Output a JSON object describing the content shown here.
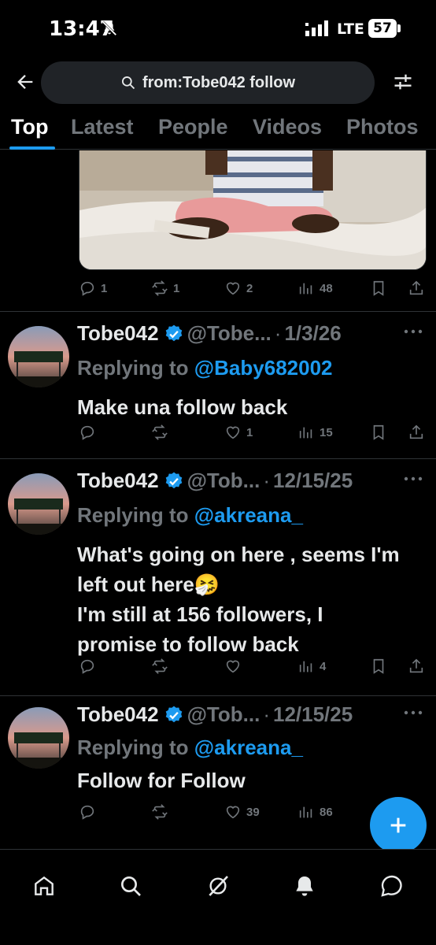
{
  "status_bar": {
    "time": "13:47",
    "network": "LTE",
    "battery": "57"
  },
  "search": {
    "query": "from:Tobe042 follow"
  },
  "tabs": [
    {
      "label": "Top",
      "active": true
    },
    {
      "label": "Latest",
      "active": false
    },
    {
      "label": "People",
      "active": false
    },
    {
      "label": "Videos",
      "active": false
    },
    {
      "label": "Photos",
      "active": false
    }
  ],
  "partial_tweet": {
    "replies": "1",
    "reposts": "1",
    "likes": "2",
    "views": "48"
  },
  "tweets": [
    {
      "display_name": "Tobe042",
      "handle": "@Tobe...",
      "date": "1/3/26",
      "replying_prefix": "Replying to",
      "replying_to": "@Baby682002",
      "text": "Make una follow back",
      "replies": "",
      "reposts": "",
      "likes": "1",
      "views": "15"
    },
    {
      "display_name": "Tobe042",
      "handle": "@Tob...",
      "date": "12/15/25",
      "replying_prefix": "Replying to",
      "replying_to": "@akreana_",
      "text": "What's going on here , seems I'm left out here🤧\nI'm still at 156 followers, I promise to follow back",
      "replies": "",
      "reposts": "",
      "likes": "",
      "views": "4"
    },
    {
      "display_name": "Tobe042",
      "handle": "@Tob...",
      "date": "12/15/25",
      "replying_prefix": "Replying to",
      "replying_to": "@akreana_",
      "text": "Follow for Follow",
      "replies": "",
      "reposts": "",
      "likes": "39",
      "views": "86"
    }
  ],
  "colors": {
    "accent": "#1d9bf0",
    "muted": "#71767b",
    "text": "#e7e9ea",
    "background": "#000000"
  },
  "icons": {
    "nav": [
      "home-icon",
      "search-icon",
      "grok-icon",
      "notifications-icon",
      "messages-icon"
    ],
    "actions": [
      "reply-icon",
      "repost-icon",
      "like-icon",
      "views-icon",
      "bookmark-icon",
      "share-icon"
    ]
  }
}
